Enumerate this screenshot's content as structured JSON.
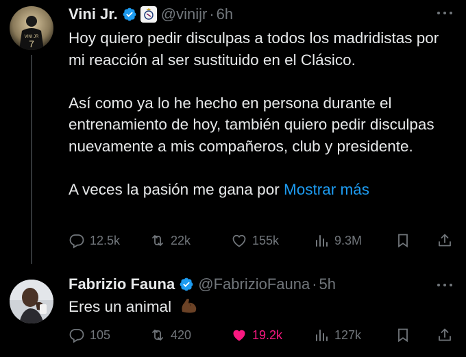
{
  "tweets": [
    {
      "name": "Vini Jr.",
      "handle": "@vinijr",
      "separator": "·",
      "time": "6h",
      "avatar_text": "VINI JR",
      "paragraphs": [
        "Hoy quiero pedir disculpas a todos los madridistas por mi reacción al ser sustituido en el Clásico.",
        "Así como ya lo he hecho en persona durante el entrenamiento de hoy, también quiero pedir disculpas nuevamente a mis compañeros, club y presidente."
      ],
      "last_paragraph": "A veces la pasión me gana por",
      "show_more": "Mostrar más",
      "stats": {
        "replies": "12.5k",
        "reposts": "22k",
        "likes": "155k",
        "views": "9.3M"
      },
      "liked": false
    },
    {
      "name": "Fabrizio Fauna",
      "handle": "@FabrizioFauna",
      "separator": "·",
      "time": "5h",
      "text": "Eres un animal",
      "emoji": "flexed-biceps-emoji",
      "stats": {
        "replies": "105",
        "reposts": "420",
        "likes": "19.2k",
        "views": "127k"
      },
      "liked": true
    }
  ],
  "colors": {
    "background": "#000000",
    "text": "#e7e9ea",
    "muted": "#71767b",
    "link": "#1d9bf0",
    "verified": "#1d9bf0",
    "like": "#f91880"
  },
  "icons": [
    "reply-icon",
    "repost-icon",
    "like-icon",
    "views-icon",
    "bookmark-icon",
    "share-icon",
    "more-icon",
    "verified-badge-icon"
  ]
}
